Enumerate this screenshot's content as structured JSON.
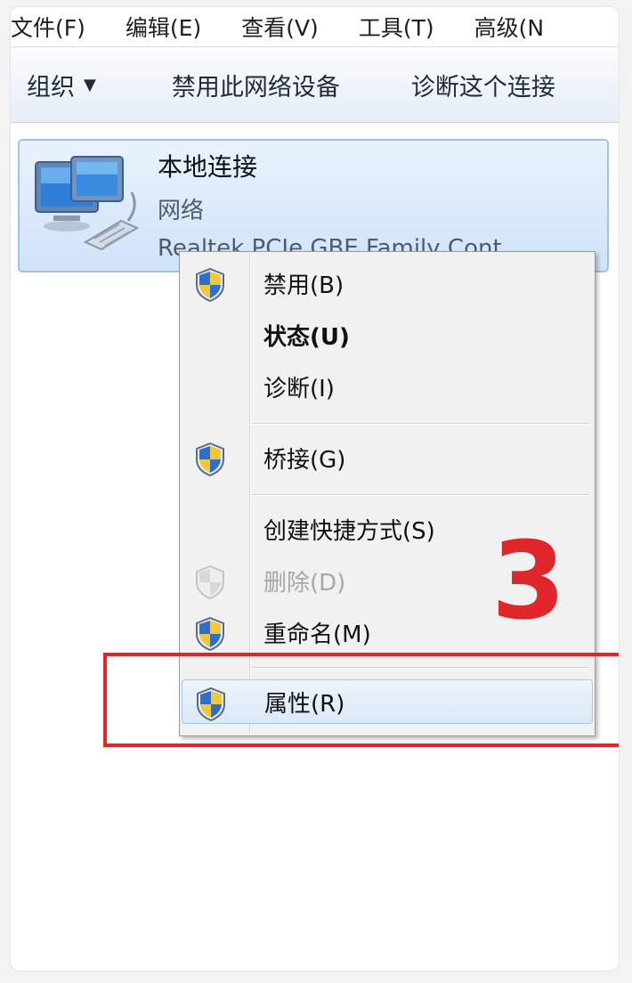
{
  "menubar": {
    "items": [
      "文件(F)",
      "编辑(E)",
      "查看(V)",
      "工具(T)",
      "高级(N"
    ]
  },
  "toolbar": {
    "organize": "组织",
    "disable_device": "禁用此网络设备",
    "diagnose": "诊断这个连接"
  },
  "connection": {
    "name": "本地连接",
    "network": "网络",
    "device": "Realtek PCIe GBE Family Cont..."
  },
  "context_menu": {
    "items": [
      {
        "label": "禁用(B)",
        "icon": "uac-shield-icon"
      },
      {
        "label": "状态(U)",
        "bold": true
      },
      {
        "label": "诊断(I)"
      },
      {
        "label": "桥接(G)",
        "icon": "uac-shield-icon"
      },
      {
        "label": "创建快捷方式(S)"
      },
      {
        "label": "删除(D)",
        "icon": "uac-shield-icon",
        "disabled": true
      },
      {
        "label": "重命名(M)",
        "icon": "uac-shield-icon"
      },
      {
        "label": "属性(R)",
        "icon": "uac-shield-icon",
        "highlighted": true
      }
    ]
  },
  "annotation": {
    "step_number": "3",
    "color": "#e0262b"
  }
}
